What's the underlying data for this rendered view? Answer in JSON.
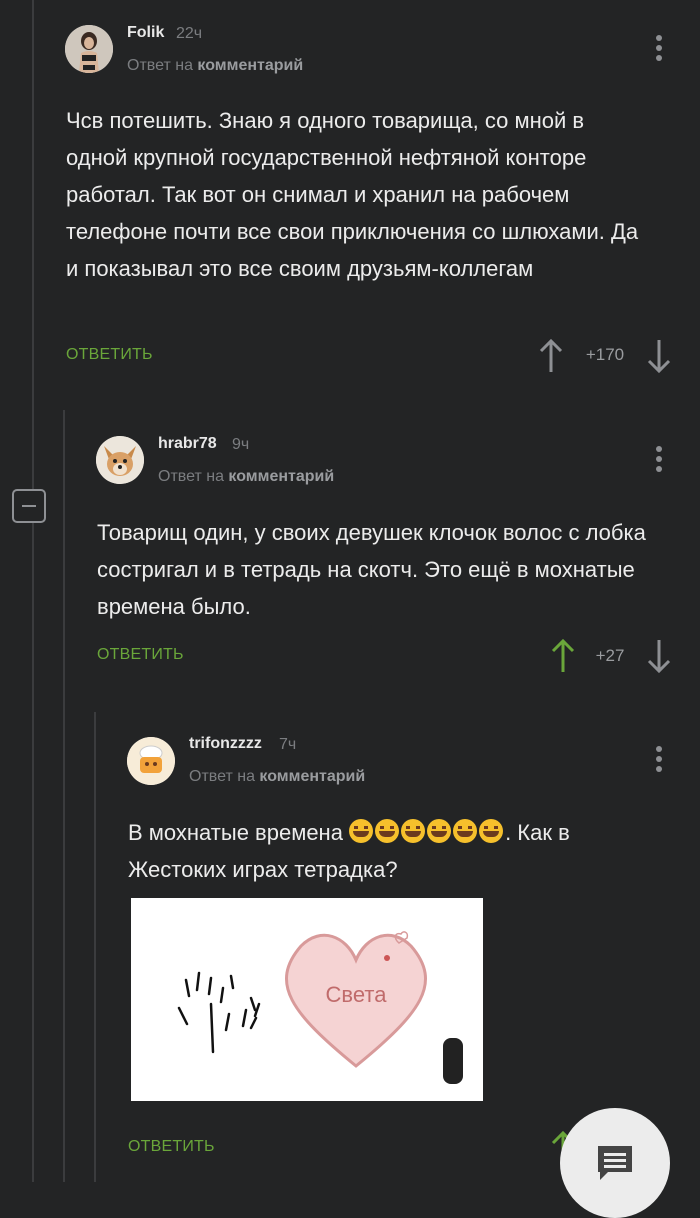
{
  "comments": [
    {
      "author": "Folik",
      "time": "22ч",
      "reply_prefix": "Ответ на",
      "reply_target": "комментарий",
      "text": "Чсв потешить. Знаю я одного товарища, со мной в одной крупной государственной нефтяной конторе работал. Так вот он снимал и хранил на рабочем телефоне почти все свои приключения со шлюхами. Да и показывал это все своим друзьям-коллегам",
      "reply_label": "ОТВЕТИТЬ",
      "score": "+170"
    },
    {
      "author": "hrabr78",
      "time": "9ч",
      "reply_prefix": "Ответ на",
      "reply_target": "комментарий",
      "text": "Товарищ один, у своих девушек клочок волос с лобка состригал и в тетрадь на скотч. Это ещё в мохнатые времена было.",
      "reply_label": "ОТВЕТИТЬ",
      "score": "+27",
      "upvoted": true
    },
    {
      "author": "trifonzzzz",
      "time": "7ч",
      "reply_prefix": "Ответ на",
      "reply_target": "комментарий",
      "text_before": "В мохнатые времена ",
      "text_after": ". Как в Жестоких играх тетрадка?",
      "emoji_count": 6,
      "image_caption": "Света",
      "reply_label": "ОТВЕТИТЬ"
    }
  ],
  "colors": {
    "background": "#232425",
    "accent_green": "#6aa63a",
    "muted": "#7b7d80"
  },
  "icons": [
    "more-vertical-icon",
    "arrow-up-icon",
    "arrow-down-icon",
    "collapse-icon",
    "chat-icon",
    "heart-icon"
  ]
}
